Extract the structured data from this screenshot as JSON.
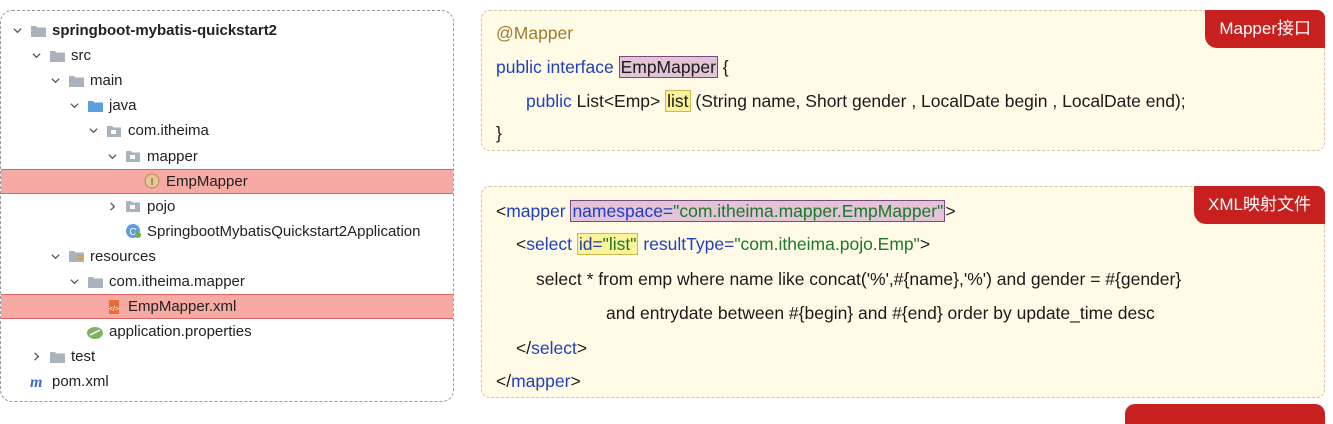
{
  "tree": {
    "items": [
      {
        "label": "springboot-mybatis-quickstart2",
        "depth": 0,
        "chev": "down",
        "icon": "folder-icon",
        "bold": true
      },
      {
        "label": "src",
        "depth": 1,
        "chev": "down",
        "icon": "folder-icon"
      },
      {
        "label": "main",
        "depth": 2,
        "chev": "down",
        "icon": "folder-icon"
      },
      {
        "label": "java",
        "depth": 3,
        "chev": "down",
        "icon": "source-folder-icon"
      },
      {
        "label": "com.itheima",
        "depth": 4,
        "chev": "down",
        "icon": "package-icon"
      },
      {
        "label": "mapper",
        "depth": 5,
        "chev": "down",
        "icon": "package-icon"
      },
      {
        "label": "EmpMapper",
        "depth": 6,
        "chev": "none",
        "icon": "interface-icon",
        "highlight": true
      },
      {
        "label": "pojo",
        "depth": 5,
        "chev": "right",
        "icon": "package-icon"
      },
      {
        "label": "SpringbootMybatisQuickstart2Application",
        "depth": 5,
        "chev": "none",
        "icon": "spring-class-icon"
      },
      {
        "label": "resources",
        "depth": 2,
        "chev": "down",
        "icon": "resources-folder-icon"
      },
      {
        "label": "com.itheima.mapper",
        "depth": 3,
        "chev": "down",
        "icon": "folder-icon"
      },
      {
        "label": "EmpMapper.xml",
        "depth": 4,
        "chev": "none",
        "icon": "xml-file-icon",
        "highlight": true
      },
      {
        "label": "application.properties",
        "depth": 3,
        "chev": "none",
        "icon": "properties-file-icon"
      },
      {
        "label": "test",
        "depth": 1,
        "chev": "right",
        "icon": "folder-icon"
      },
      {
        "label": "pom.xml",
        "depth": 0,
        "chev": "none",
        "icon": "maven-icon"
      }
    ]
  },
  "panel1": {
    "tag": "Mapper接口",
    "annotation": "@Mapper",
    "l2_kw": "public interface ",
    "l2_name": "EmpMapper",
    "l2_tail": " {",
    "l3_kw": "public ",
    "l3_type": "List<Emp> ",
    "l3_method": "list",
    "l3_params": " (String name, Short gender , LocalDate begin , LocalDate end);",
    "l4": "}"
  },
  "panel2": {
    "tag": "XML映射文件",
    "m_open": "<",
    "m_tag": "mapper",
    "m_ns_attr": "namespace=",
    "m_ns_val": "\"com.itheima.mapper.EmpMapper\"",
    "m_close": ">",
    "s_open": "<",
    "s_tag": "select",
    "s_id_attr": "id=",
    "s_id_val": "\"list\"",
    "s_rt_attr": " resultType=",
    "s_rt_val": "\"com.itheima.pojo.Emp\"",
    "s_close": ">",
    "sql1": "select * from emp where name like concat('%',#{name},'%') and gender = #{gender}",
    "sql2": "and entrydate between #{begin} and #{end} order by update_time desc",
    "end_select_open": "</",
    "end_select_tag": "select",
    "end_select_close": ">",
    "end_mapper_open": "</",
    "end_mapper_tag": "mapper",
    "end_mapper_close": ">"
  },
  "colors": {
    "keyword": "#1f3fbf",
    "annotation": "#9b7d2e",
    "string": "#1a7a2a",
    "tag": "#c8201e"
  }
}
